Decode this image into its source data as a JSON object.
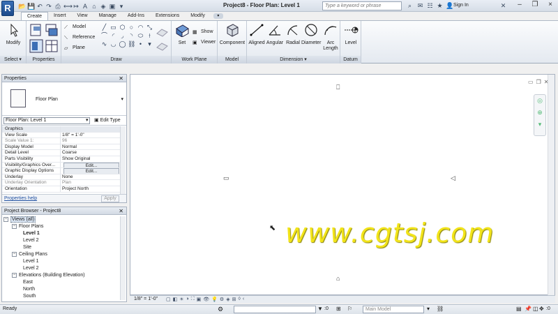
{
  "titlebar": {
    "app_letter": "R",
    "title": "Project8 - Floor Plan: Level 1",
    "search_placeholder": "Type a keyword or phrase",
    "signin": "Sign In",
    "qat_icons": [
      "open-icon",
      "save-icon",
      "undo-icon",
      "redo-icon",
      "print-icon",
      "measure-icon",
      "dimension-icon",
      "text-icon",
      "3d-icon",
      "section-icon",
      "close-views-icon",
      "switch-windows-icon"
    ]
  },
  "tabs": [
    "Create",
    "Insert",
    "View",
    "Manage",
    "Add-Ins",
    "Extensions",
    "Modify"
  ],
  "ribbon": {
    "select": {
      "modify": "Modify",
      "label": "Select ▾"
    },
    "properties": {
      "label": "Properties"
    },
    "draw": {
      "model": "Model",
      "reference": "Reference",
      "plane": "Plane",
      "label": "Draw"
    },
    "workplane": {
      "set": "Set",
      "show": "Show",
      "viewer": "Viewer",
      "label": "Work Plane"
    },
    "model": {
      "component": "Component",
      "label": "Model"
    },
    "dimension": {
      "aligned": "Aligned",
      "angular": "Angular",
      "radial": "Radial",
      "diameter": "Diameter",
      "arc_length": "Arc\nLength",
      "label": "Dimension ▾"
    },
    "datum": {
      "level": "Level",
      "label": "Datum"
    }
  },
  "properties": {
    "title": "Properties",
    "type_name": "Floor Plan",
    "instance_selector": "Floor Plan: Level 1",
    "edit_type": "Edit Type",
    "rows": [
      {
        "k": "Graphics",
        "v": "",
        "group": true
      },
      {
        "k": "View Scale",
        "v": "1/8\" = 1'-0\""
      },
      {
        "k": "Scale Value    1:",
        "v": "96",
        "grey": true
      },
      {
        "k": "Display Model",
        "v": "Normal"
      },
      {
        "k": "Detail Level",
        "v": "Coarse"
      },
      {
        "k": "Parts Visibility",
        "v": "Show Original"
      },
      {
        "k": "Visibility/Graphics Over...",
        "v": "Edit...",
        "button": true
      },
      {
        "k": "Graphic Display Options",
        "v": "Edit...",
        "button": true
      },
      {
        "k": "Underlay",
        "v": "None"
      },
      {
        "k": "Underlay Orientation",
        "v": "Plan",
        "grey": true
      },
      {
        "k": "Orientation",
        "v": "Project North"
      }
    ],
    "help": "Properties help",
    "apply": "Apply"
  },
  "browser": {
    "title": "Project Browser - Project8",
    "tree": [
      {
        "label": "Views (all)",
        "level": 0,
        "toggle": "−",
        "selected": true
      },
      {
        "label": "Floor Plans",
        "level": 1,
        "toggle": "−"
      },
      {
        "label": "Level 1",
        "level": 2,
        "bold": true
      },
      {
        "label": "Level 2",
        "level": 2
      },
      {
        "label": "Site",
        "level": 2
      },
      {
        "label": "Ceiling Plans",
        "level": 1,
        "toggle": "−"
      },
      {
        "label": "Level 1",
        "level": 2
      },
      {
        "label": "Level 2",
        "level": 2
      },
      {
        "label": "Elevations (Building Elevation)",
        "level": 1,
        "toggle": "−"
      },
      {
        "label": "East",
        "level": 2
      },
      {
        "label": "North",
        "level": 2
      },
      {
        "label": "South",
        "level": 2
      }
    ]
  },
  "canvas": {
    "watermark": "www.cgtsj.com"
  },
  "viewbar": {
    "scale": "1/8\" = 1'-0\""
  },
  "status": {
    "text": "Ready",
    "selection_count": ":0",
    "model": "Main Model",
    "filter_count": ":0"
  }
}
